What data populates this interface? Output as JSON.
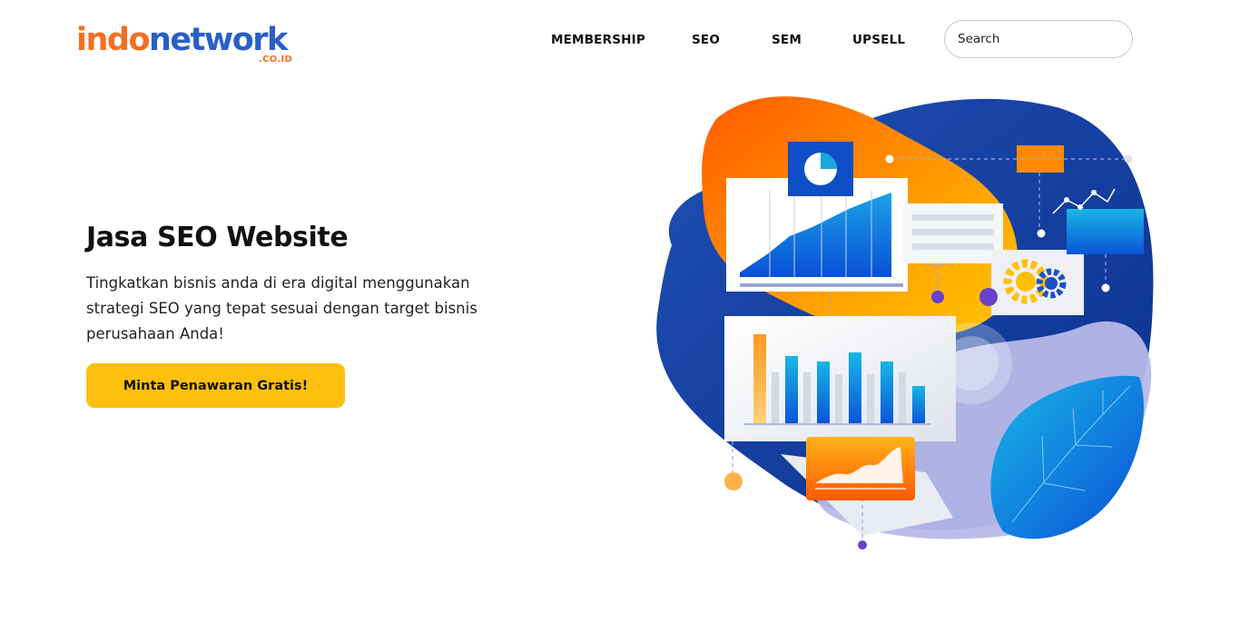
{
  "brand": {
    "logo_part1": "indo",
    "logo_part2": "network",
    "logo_suffix": ".CO.ID",
    "colors": {
      "orange": "#f36f21",
      "blue": "#2a5fc7",
      "cta_yellow": "#fdc00f"
    }
  },
  "nav": {
    "items": [
      {
        "label": "MEMBERSHIP"
      },
      {
        "label": "SEO"
      },
      {
        "label": "SEM"
      },
      {
        "label": "UPSELL"
      }
    ],
    "search": {
      "placeholder": "Search",
      "value": ""
    }
  },
  "hero": {
    "title": "Jasa SEO Website",
    "description": "Tingkatkan bisnis anda di era digital menggunakan strategi SEO yang tepat sesuai dengan target bisnis perusahaan Anda!",
    "cta_label": "Minta Penawaran Gratis!"
  },
  "illustration": {
    "icons": [
      "pie-chart-icon",
      "area-chart-panel",
      "bar-chart-panel",
      "gear-icon",
      "leaf-icon",
      "line-chart-icon"
    ]
  }
}
